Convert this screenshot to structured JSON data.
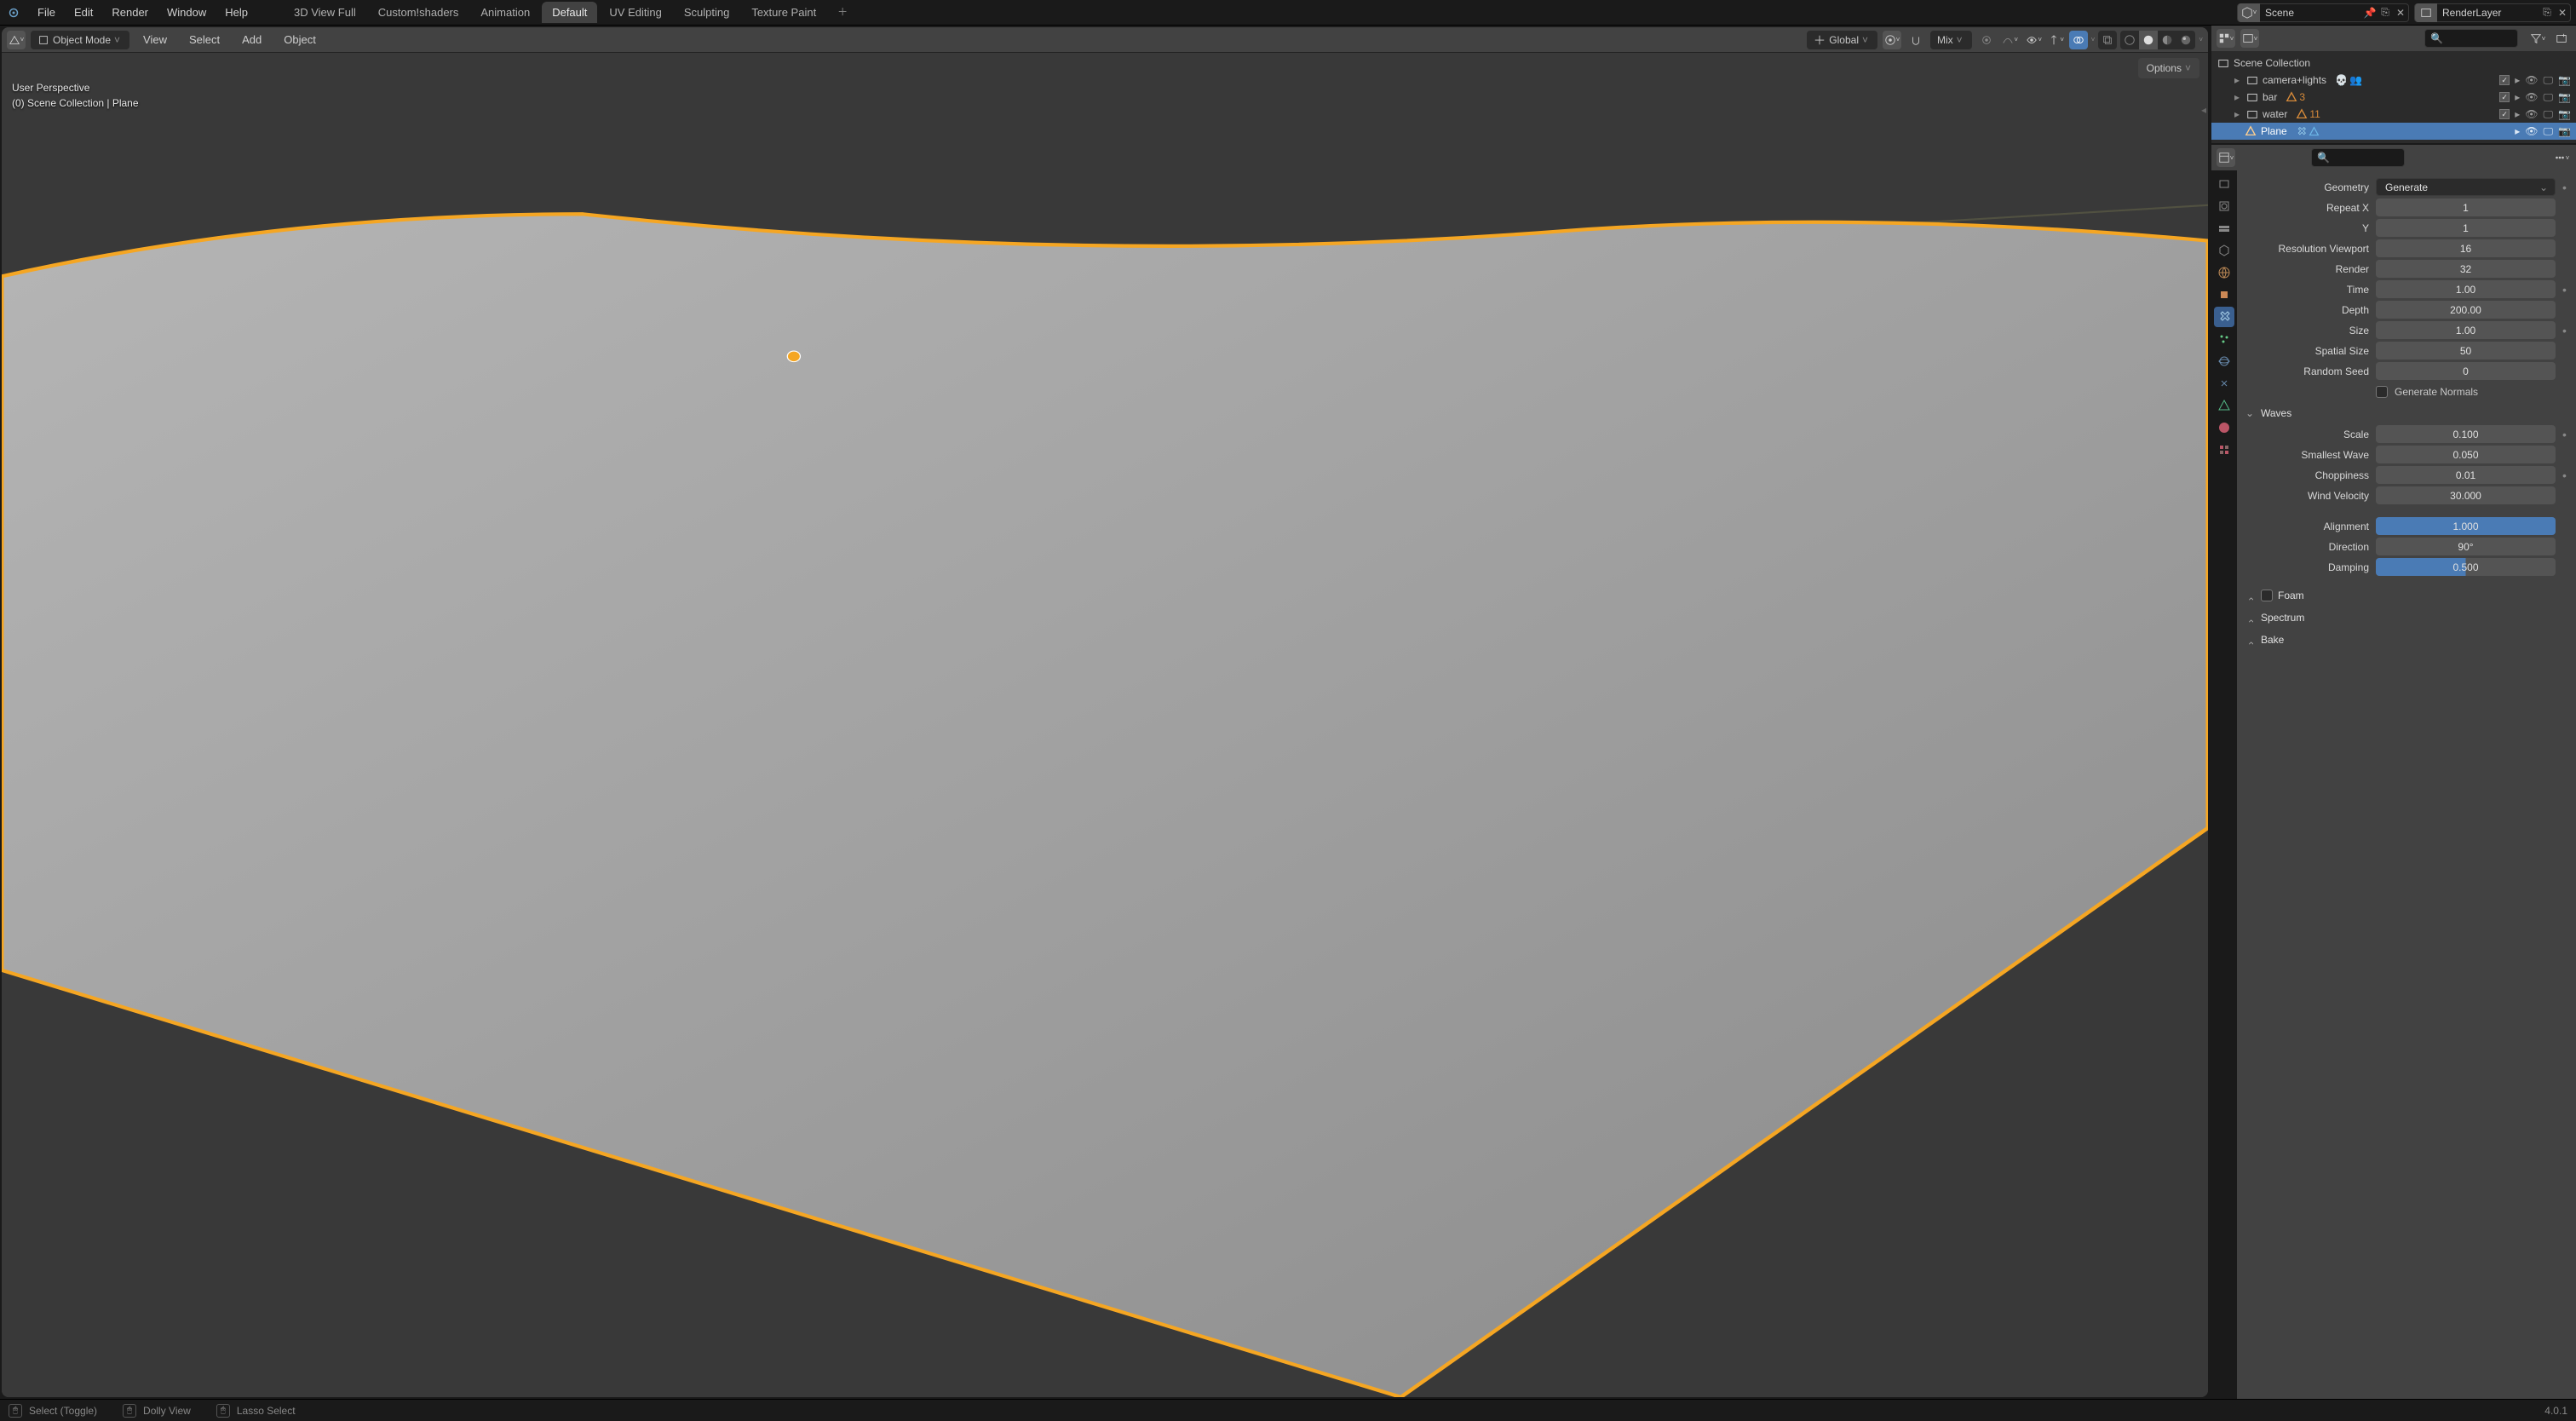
{
  "menubar": {
    "items": [
      "File",
      "Edit",
      "Render",
      "Window",
      "Help"
    ]
  },
  "workspaces": {
    "tabs": [
      "3D View Full",
      "Custom!shaders",
      "Animation",
      "Default",
      "UV Editing",
      "Sculpting",
      "Texture Paint"
    ],
    "active": 3
  },
  "scene": {
    "label": "Scene"
  },
  "layer": {
    "label": "RenderLayer"
  },
  "viewport_header": {
    "mode": "Object Mode",
    "menus": [
      "View",
      "Select",
      "Add",
      "Object"
    ],
    "orientation": "Global",
    "snap": "Mix"
  },
  "viewport_info": {
    "line1": "User Perspective",
    "line2": "(0) Scene Collection | Plane"
  },
  "options_label": "Options",
  "outliner": {
    "root": "Scene Collection",
    "items": [
      {
        "name": "camera+lights",
        "kind": "collection",
        "count": "",
        "extras": [
          "skull",
          "people"
        ]
      },
      {
        "name": "bar",
        "kind": "collection",
        "count": "3",
        "extras": []
      },
      {
        "name": "water",
        "kind": "collection",
        "count": "11",
        "extras": []
      },
      {
        "name": "Plane",
        "kind": "mesh",
        "selected": true,
        "extras": [
          "wrench",
          "vgroup"
        ]
      }
    ]
  },
  "geometry": {
    "label": "Geometry",
    "mode": "Generate",
    "repeat_x": {
      "label": "Repeat X",
      "value": "1"
    },
    "repeat_y": {
      "label": "Y",
      "value": "1"
    },
    "res_viewport": {
      "label": "Resolution Viewport",
      "value": "16"
    },
    "render": {
      "label": "Render",
      "value": "32"
    },
    "time": {
      "label": "Time",
      "value": "1.00"
    },
    "depth": {
      "label": "Depth",
      "value": "200.00"
    },
    "size": {
      "label": "Size",
      "value": "1.00"
    },
    "spatial": {
      "label": "Spatial Size",
      "value": "50"
    },
    "seed": {
      "label": "Random Seed",
      "value": "0"
    },
    "normals": "Generate Normals"
  },
  "waves": {
    "title": "Waves",
    "scale": {
      "label": "Scale",
      "value": "0.100"
    },
    "smallest": {
      "label": "Smallest Wave",
      "value": "0.050"
    },
    "chop": {
      "label": "Choppiness",
      "value": "0.01"
    },
    "wind": {
      "label": "Wind Velocity",
      "value": "30.000"
    },
    "align": {
      "label": "Alignment",
      "value": "1.000"
    },
    "dir": {
      "label": "Direction",
      "value": "90°"
    },
    "damp": {
      "label": "Damping",
      "value": "0.500"
    }
  },
  "panels_collapsed": {
    "foam": "Foam",
    "spectrum": "Spectrum",
    "bake": "Bake"
  },
  "statusbar": {
    "select": "Select (Toggle)",
    "dolly": "Dolly View",
    "lasso": "Lasso Select",
    "version": "4.0.1"
  }
}
